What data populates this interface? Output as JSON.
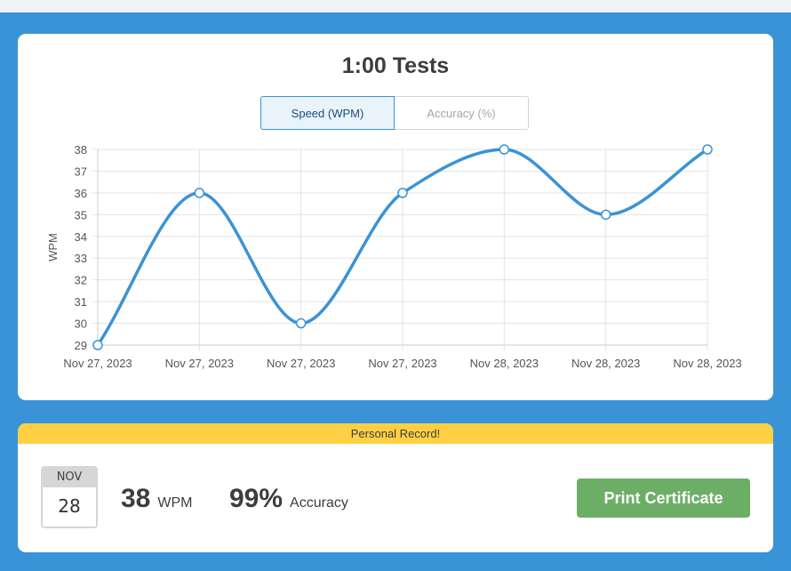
{
  "chart_panel": {
    "title": "1:00 Tests",
    "tabs": [
      {
        "label": "Speed (WPM)",
        "active": true
      },
      {
        "label": "Accuracy (%)",
        "active": false
      }
    ]
  },
  "chart_data": {
    "type": "line",
    "x": [
      "Nov 27, 2023",
      "Nov 27, 2023",
      "Nov 27, 2023",
      "Nov 27, 2023",
      "Nov 28, 2023",
      "Nov 28, 2023",
      "Nov 28, 2023"
    ],
    "series": [
      {
        "values": [
          29,
          36,
          30,
          36,
          38,
          35,
          38
        ]
      }
    ],
    "ylabel": "WPM",
    "ylim": [
      29,
      38
    ],
    "yticks": [
      29,
      30,
      31,
      32,
      33,
      34,
      35,
      36,
      37,
      38
    ],
    "grid": true,
    "line_color": "#3a93d6"
  },
  "record": {
    "banner": "Personal Record!",
    "date_month": "NOV",
    "date_day": "28",
    "wpm_value": "38",
    "wpm_unit": "WPM",
    "accuracy_value": "99%",
    "accuracy_unit": "Accuracy",
    "print_label": "Print Certificate"
  },
  "colors": {
    "background": "#3a93d6",
    "banner": "#ffd043",
    "print_button": "#6cae66"
  }
}
